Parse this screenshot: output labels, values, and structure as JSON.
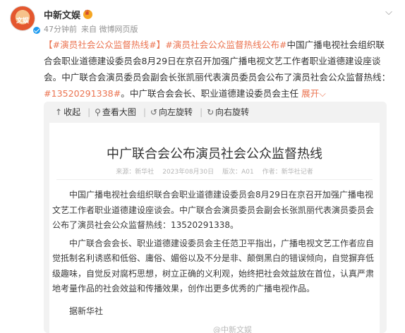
{
  "post": {
    "author": "中新文娱",
    "time": "47分钟前",
    "source": "来自 微博网页版",
    "hashtag1": "【#演员社会公众监督热线#】",
    "hashtag2": "#演员社会公众监督热线公布#",
    "text_line1_rest": "中国广播电视社会组织联合",
    "text_line2": "会职业道德建设委员会8月29日在京召开加强广播电视文艺工作者职业道德建设座谈",
    "text_line3": "会。中广联合会演员委员会副会长张凯丽代表演员委员会公布了演员社会公众监督热",
    "text_line4_prefix": "线：",
    "phone_tag": "#13520291338#",
    "text_line4_rest": "。中广联合会会长、职业道德建设委员会主任",
    "expand": "展开",
    "avatar_text": "文娱"
  },
  "toolbar": {
    "collapse": "收起",
    "view_large": "查看大图",
    "rotate_left": "向左旋转",
    "rotate_right": "向右旋转"
  },
  "doc": {
    "title": "中广联合会公布演员社会公众监督热线",
    "meta_source": "来源：新华社",
    "meta_date": "2023年08月30日",
    "meta_edition": "版次：A01",
    "meta_author": "作者：新华社记者",
    "para1": "中国广播电视社会组织联合会职业道德建设委员会8月29日在京召开加强广播电视文艺工作者职业道德建设座谈会。中广联合会演员委员会副会长张凯丽代表演员委员会公布了演员社会公众监督热线：13520291338。",
    "para2": "中广联合会会长、职业道德建设委员会主任范卫平指出，广播电视文艺工作者应自觉抵制名利诱惑和低俗、庸俗、媚俗以及不分是非、颠倒黑白的错误倾向，自觉摒弃低级趣味，自觉反对腐朽思想，树立正确的义利观，始终把社会效益放在首位，认真严肃地考量作品的社会效益和传播效果，创作出更多优秀的广播电视作品。",
    "source": "据新华社",
    "watermark": "@中新文娱"
  }
}
